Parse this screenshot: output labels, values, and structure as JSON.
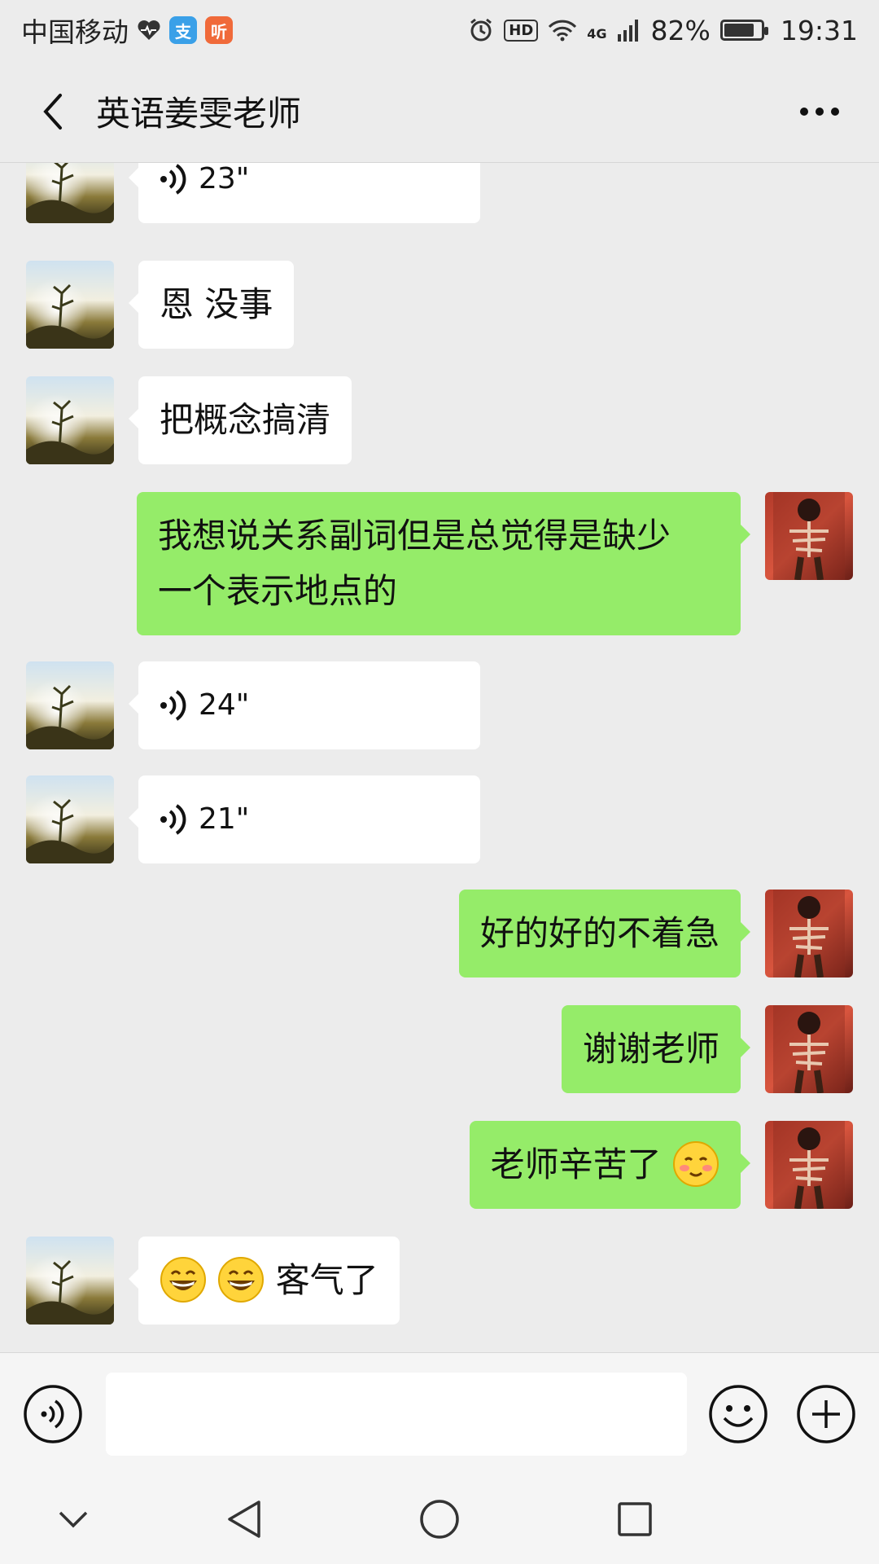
{
  "status_bar": {
    "carrier": "中国移动",
    "app_badge_1": "支",
    "app_badge_2": "听",
    "hd_label": "HD",
    "network_label": "4G",
    "battery_percent": "82%",
    "battery_level": 0.82,
    "time": "19:31"
  },
  "header": {
    "title": "英语姜雯老师"
  },
  "messages": [
    {
      "side": "left",
      "type": "voice",
      "duration": "23\""
    },
    {
      "side": "left",
      "type": "text",
      "text": "恩 没事"
    },
    {
      "side": "left",
      "type": "text",
      "text": "把概念搞清"
    },
    {
      "side": "right",
      "type": "text",
      "line1": "我想说关系副词但是总觉得是缺少",
      "line2": "一个表示地点的"
    },
    {
      "side": "left",
      "type": "voice",
      "duration": "24\""
    },
    {
      "side": "left",
      "type": "voice",
      "duration": "21\""
    },
    {
      "side": "right",
      "type": "text",
      "text": "好的好的不着急"
    },
    {
      "side": "right",
      "type": "text",
      "text": "谢谢老师"
    },
    {
      "side": "right",
      "type": "text+emoji",
      "text": "老师辛苦了",
      "emoji": "blush-emoji"
    },
    {
      "side": "left",
      "type": "emoji+text",
      "emoji": "grin-emoji",
      "text": "客气了"
    }
  ],
  "input_bar": {
    "input_value": "",
    "voice_icon": "voice-mode-icon",
    "emoji_icon": "emoji-icon",
    "plus_icon": "plus-icon"
  },
  "colors": {
    "bubble_self": "#95ec69",
    "bubble_other": "#ffffff",
    "background": "#ececec"
  }
}
